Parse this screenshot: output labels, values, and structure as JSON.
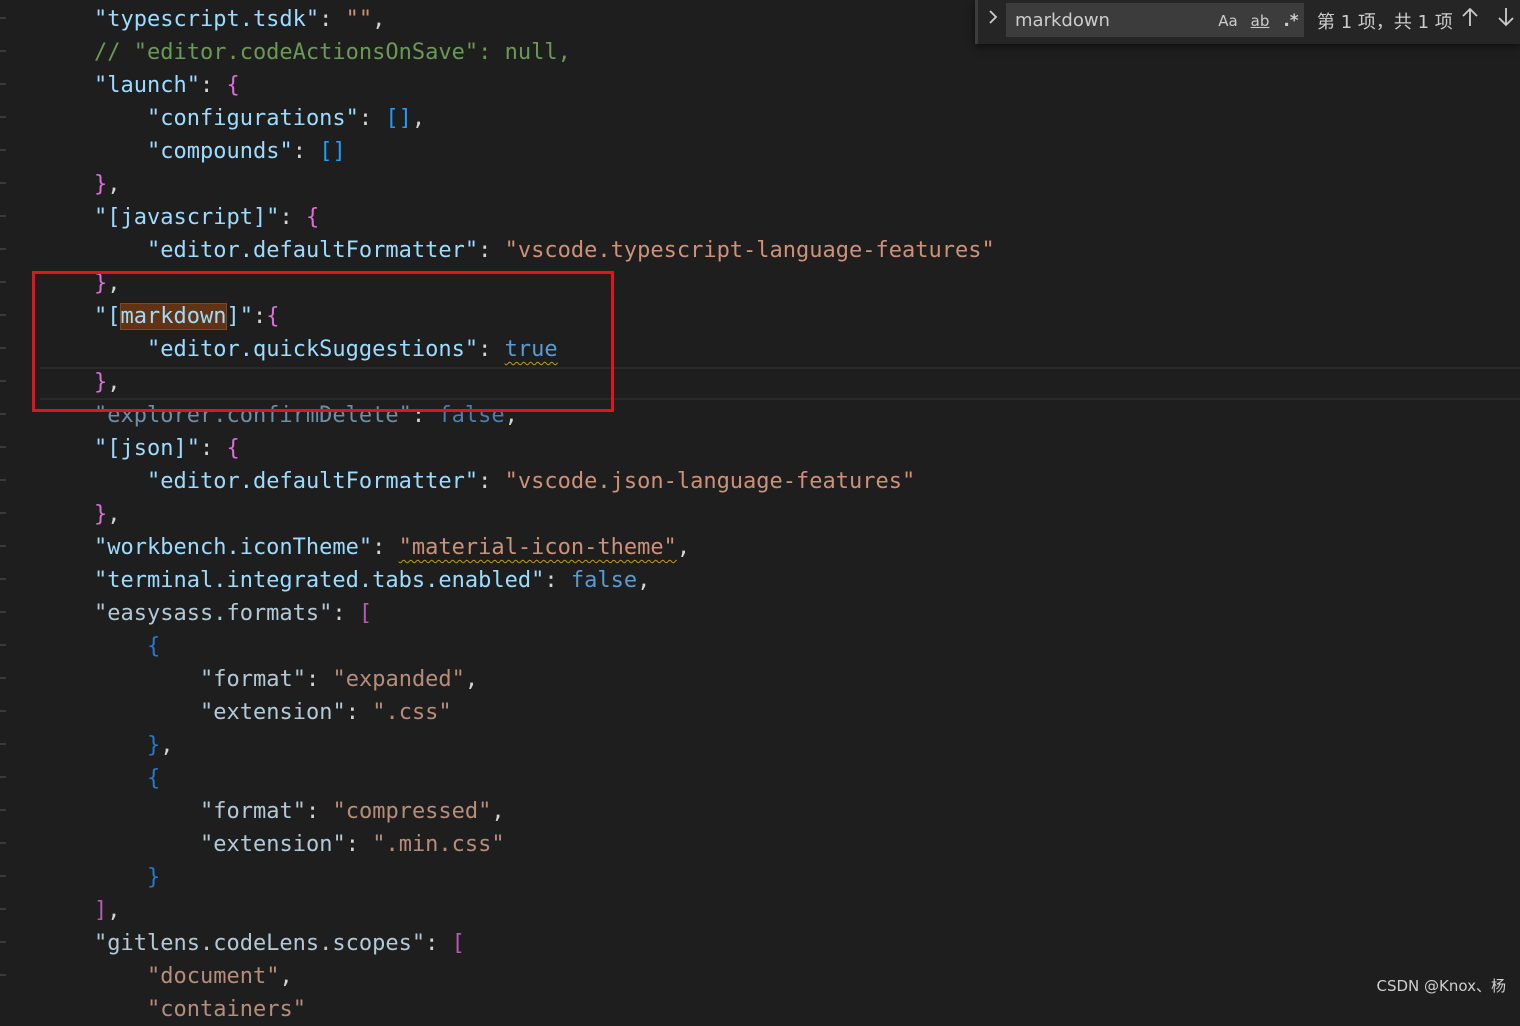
{
  "find_widget": {
    "query": "markdown",
    "match_case_label": "Aa",
    "whole_word_label": "ab",
    "regex_label": ".*",
    "match_count": "第 1 项，共 1 项",
    "toggle_icon": "chevron-right-icon",
    "prev_icon": "arrow-up-icon",
    "next_icon": "arrow-down-icon"
  },
  "code": {
    "l1_key": "\"typescript.tsdk\"",
    "l1_val": "\"\"",
    "l2_comment": "// \"editor.codeActionsOnSave\": null,",
    "l3_key": "\"launch\"",
    "l4_key": "\"configurations\"",
    "l5_key": "\"compounds\"",
    "l7_key": "\"[javascript]\"",
    "l8_key": "\"editor.defaultFormatter\"",
    "l8_val": "\"vscode.typescript-language-features\"",
    "l10_key_pre": "\"[",
    "l10_key_match": "markdown",
    "l10_key_post": "]\"",
    "l11_key": "\"editor.quickSuggestions\"",
    "l11_val": "true",
    "l13_key": "\"explorer.confirmDelete\"",
    "l13_val": "false",
    "l14_key": "\"[json]\"",
    "l15_key": "\"editor.defaultFormatter\"",
    "l15_val": "\"vscode.json-language-features\"",
    "l17_key": "\"workbench.iconTheme\"",
    "l17_val": "\"material-icon-theme\"",
    "l18_key": "\"terminal.integrated.tabs.enabled\"",
    "l18_val": "false",
    "l19_key": "\"easysass.formats\"",
    "l21_key": "\"format\"",
    "l21_val": "\"expanded\"",
    "l22_key": "\"extension\"",
    "l22_val": "\".css\"",
    "l25_key": "\"format\"",
    "l25_val": "\"compressed\"",
    "l26_key": "\"extension\"",
    "l26_val": "\".min.css\"",
    "l29_key": "\"gitlens.codeLens.scopes\"",
    "l30_val": "\"document\"",
    "l31_val": "\"containers\""
  },
  "watermark": "CSDN @Knox、杨",
  "colors": {
    "background": "#1e1e1e",
    "property": "#9cdcfe",
    "string": "#ce9178",
    "comment": "#6a9955",
    "keyword": "#569cd6",
    "highlight_box": "#e0141e",
    "find_match": "#613214"
  }
}
